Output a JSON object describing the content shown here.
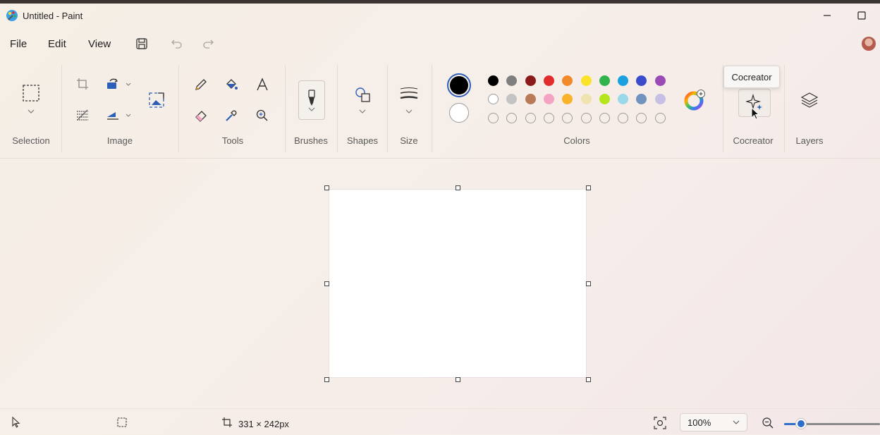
{
  "window": {
    "title": "Untitled - Paint"
  },
  "menu": {
    "file": "File",
    "edit": "Edit",
    "view": "View"
  },
  "ribbon": {
    "groups": {
      "selection": "Selection",
      "image": "Image",
      "tools": "Tools",
      "brushes": "Brushes",
      "shapes": "Shapes",
      "size": "Size",
      "colors": "Colors",
      "cocreator": "Cocreator",
      "layers": "Layers"
    }
  },
  "tooltip": {
    "text": "Cocreator"
  },
  "colors": {
    "primary": "#000000",
    "secondary": "#ffffff",
    "palette_row1": [
      "#000000",
      "#7f7f7f",
      "#8b1a1a",
      "#e22b2b",
      "#f28a2c",
      "#fbe32c",
      "#2fb34a",
      "#1ba0e0",
      "#3a4bcc",
      "#9b4bb6"
    ],
    "palette_row2": [
      "#ffffff",
      "#c3c3c3",
      "#b97a57",
      "#f5a3c3",
      "#f8b32a",
      "#efe4b0",
      "#b5e61d",
      "#99d9ea",
      "#7092be",
      "#c8bfe7"
    ]
  },
  "status": {
    "canvas_size": "331 × 242px",
    "zoom": "100%"
  }
}
